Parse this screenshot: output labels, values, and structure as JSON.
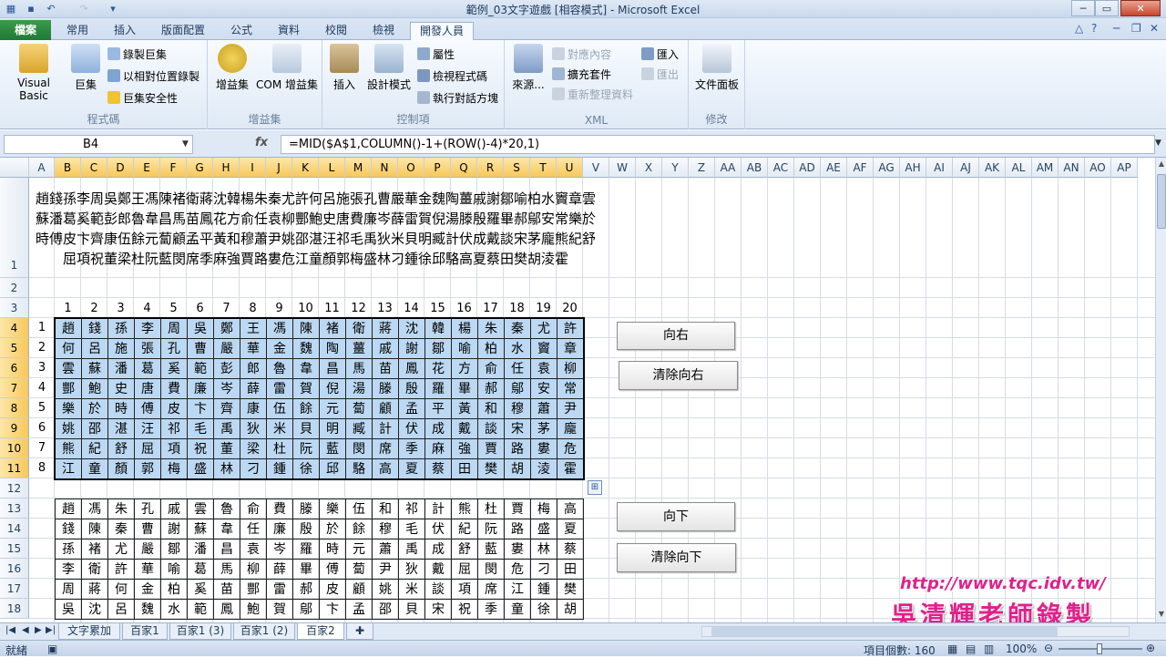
{
  "window": {
    "title": "範例_03文字遊戲 [相容模式] - Microsoft Excel"
  },
  "ribbon_tabs": [
    {
      "label": "檔案"
    },
    {
      "label": "常用"
    },
    {
      "label": "插入"
    },
    {
      "label": "版面配置"
    },
    {
      "label": "公式"
    },
    {
      "label": "資料"
    },
    {
      "label": "校閱"
    },
    {
      "label": "檢視"
    },
    {
      "label": "開發人員"
    }
  ],
  "ribbon": {
    "code_group": {
      "label": "程式碼",
      "visual_basic": "Visual Basic",
      "macros": "巨集",
      "record_macro": "錄製巨集",
      "relative_ref": "以相對位置錄製",
      "macro_security": "巨集安全性"
    },
    "addins_group": {
      "label": "增益集",
      "addins": "增益集",
      "com_addins": "COM 增益集"
    },
    "controls_group": {
      "label": "控制項",
      "insert": "插入",
      "design_mode": "設計模式",
      "properties": "屬性",
      "view_code": "檢視程式碼",
      "run_dialog": "執行對話方塊"
    },
    "xml_group": {
      "label": "XML",
      "source": "來源...",
      "map_properties": "對應內容",
      "expansion_packs": "擴充套件",
      "refresh_data": "重新整理資料",
      "import": "匯入",
      "export": "匯出"
    },
    "modify_group": {
      "label": "修改",
      "document_panel": "文件面板"
    }
  },
  "formula_bar": {
    "name_box": "B4",
    "fx": "fx",
    "formula": "=MID($A$1,COLUMN()-1+(ROW()-4)*20,1)"
  },
  "columns": [
    "A",
    "B",
    "C",
    "D",
    "E",
    "F",
    "G",
    "H",
    "I",
    "J",
    "K",
    "L",
    "M",
    "N",
    "O",
    "P",
    "Q",
    "R",
    "S",
    "T",
    "U",
    "V",
    "W",
    "X",
    "Y",
    "Z",
    "AA",
    "AB",
    "AC",
    "AD",
    "AE",
    "AF",
    "AG",
    "AH",
    "AI",
    "AJ",
    "AK",
    "AL",
    "AM",
    "AN",
    "AO",
    "AP"
  ],
  "rows": [
    "1",
    "2",
    "3",
    "4",
    "5",
    "6",
    "7",
    "8",
    "9",
    "10",
    "11",
    "12",
    "13",
    "14",
    "15",
    "16",
    "17",
    "18"
  ],
  "a1_text": [
    "趙錢孫李周吳鄭王馮陳褚衛蔣沈韓楊朱秦尤許何呂施張孔曹嚴華金魏陶薑戚謝鄒喻柏水竇章雲",
    "蘇潘葛奚範彭郎魯韋昌馬苗鳳花方俞任袁柳酆鮑史唐費廉岑薛雷賀倪湯滕殷羅畢郝鄔安常樂於",
    "時傅皮卞齊康伍餘元蔔顧孟平黃和穆蕭尹姚邵湛汪祁毛禹狄米貝明臧計伏成戴談宋茅龐熊紀舒",
    "屈項祝董梁杜阮藍閔席季麻強賈路婁危江童顏郭梅盛林刁鍾徐邱駱高夏蔡田樊胡淩霍"
  ],
  "header_numbers": [
    "1",
    "2",
    "3",
    "4",
    "5",
    "6",
    "7",
    "8",
    "9",
    "10",
    "11",
    "12",
    "13",
    "14",
    "15",
    "16",
    "17",
    "18",
    "19",
    "20"
  ],
  "right_grid": {
    "row_labels": [
      "1",
      "2",
      "3",
      "4",
      "5",
      "6",
      "7",
      "8"
    ],
    "rows": [
      [
        "趙",
        "錢",
        "孫",
        "李",
        "周",
        "吳",
        "鄭",
        "王",
        "馮",
        "陳",
        "褚",
        "衛",
        "蔣",
        "沈",
        "韓",
        "楊",
        "朱",
        "秦",
        "尤",
        "許"
      ],
      [
        "何",
        "呂",
        "施",
        "張",
        "孔",
        "曹",
        "嚴",
        "華",
        "金",
        "魏",
        "陶",
        "薑",
        "戚",
        "謝",
        "鄒",
        "喻",
        "柏",
        "水",
        "竇",
        "章"
      ],
      [
        "雲",
        "蘇",
        "潘",
        "葛",
        "奚",
        "範",
        "彭",
        "郎",
        "魯",
        "韋",
        "昌",
        "馬",
        "苗",
        "鳳",
        "花",
        "方",
        "俞",
        "任",
        "袁",
        "柳"
      ],
      [
        "酆",
        "鮑",
        "史",
        "唐",
        "費",
        "廉",
        "岑",
        "薛",
        "雷",
        "賀",
        "倪",
        "湯",
        "滕",
        "殷",
        "羅",
        "畢",
        "郝",
        "鄔",
        "安",
        "常"
      ],
      [
        "樂",
        "於",
        "時",
        "傅",
        "皮",
        "卞",
        "齊",
        "康",
        "伍",
        "餘",
        "元",
        "蔔",
        "顧",
        "孟",
        "平",
        "黃",
        "和",
        "穆",
        "蕭",
        "尹"
      ],
      [
        "姚",
        "邵",
        "湛",
        "汪",
        "祁",
        "毛",
        "禹",
        "狄",
        "米",
        "貝",
        "明",
        "臧",
        "計",
        "伏",
        "成",
        "戴",
        "談",
        "宋",
        "茅",
        "龐"
      ],
      [
        "熊",
        "紀",
        "舒",
        "屈",
        "項",
        "祝",
        "董",
        "梁",
        "杜",
        "阮",
        "藍",
        "閔",
        "席",
        "季",
        "麻",
        "強",
        "賈",
        "路",
        "婁",
        "危"
      ],
      [
        "江",
        "童",
        "顏",
        "郭",
        "梅",
        "盛",
        "林",
        "刁",
        "鍾",
        "徐",
        "邱",
        "駱",
        "高",
        "夏",
        "蔡",
        "田",
        "樊",
        "胡",
        "淩",
        "霍"
      ]
    ]
  },
  "down_grid": {
    "rows": [
      [
        "趙",
        "馮",
        "朱",
        "孔",
        "戚",
        "雲",
        "魯",
        "俞",
        "費",
        "滕",
        "樂",
        "伍",
        "和",
        "祁",
        "計",
        "熊",
        "杜",
        "賈",
        "梅",
        "高"
      ],
      [
        "錢",
        "陳",
        "秦",
        "曹",
        "謝",
        "蘇",
        "韋",
        "任",
        "廉",
        "殷",
        "於",
        "餘",
        "穆",
        "毛",
        "伏",
        "紀",
        "阮",
        "路",
        "盛",
        "夏"
      ],
      [
        "孫",
        "褚",
        "尤",
        "嚴",
        "鄒",
        "潘",
        "昌",
        "袁",
        "岑",
        "羅",
        "時",
        "元",
        "蕭",
        "禹",
        "成",
        "舒",
        "藍",
        "婁",
        "林",
        "蔡"
      ],
      [
        "李",
        "衛",
        "許",
        "華",
        "喻",
        "葛",
        "馬",
        "柳",
        "薛",
        "畢",
        "傅",
        "蔔",
        "尹",
        "狄",
        "戴",
        "屈",
        "閔",
        "危",
        "刁",
        "田"
      ],
      [
        "周",
        "蔣",
        "何",
        "金",
        "柏",
        "奚",
        "苗",
        "酆",
        "雷",
        "郝",
        "皮",
        "顧",
        "姚",
        "米",
        "談",
        "項",
        "席",
        "江",
        "鍾",
        "樊"
      ],
      [
        "吳",
        "沈",
        "呂",
        "魏",
        "水",
        "範",
        "鳳",
        "鮑",
        "賀",
        "鄔",
        "卞",
        "孟",
        "邵",
        "貝",
        "宋",
        "祝",
        "季",
        "童",
        "徐",
        "胡"
      ]
    ]
  },
  "buttons": {
    "right": "向右",
    "clear_right": "清除向右",
    "down": "向下",
    "clear_down": "清除向下"
  },
  "sheet_tabs": [
    "文字累加",
    "百家1",
    "百家1 (3)",
    "百家1 (2)",
    "百家2"
  ],
  "active_sheet": "百家2",
  "status": {
    "ready": "就緒",
    "count_label": "項目個數: 160",
    "zoom": "100%"
  },
  "watermark": {
    "url": "http://www.tqc.idv.tw/",
    "author": "吳清輝老師錄製"
  }
}
